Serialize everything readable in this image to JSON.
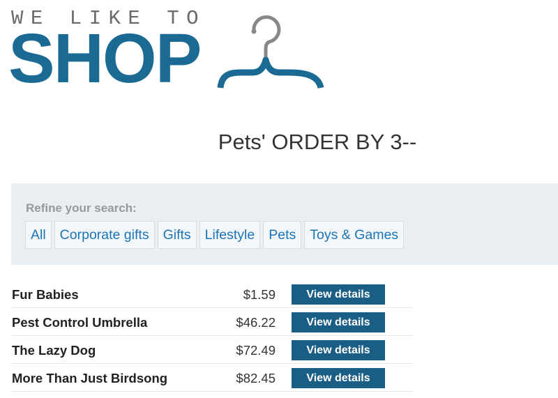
{
  "logo": {
    "tagline": "WE LIKE TO",
    "word": "SHOP",
    "icon": "hanger-icon",
    "color": "#1a6a94"
  },
  "page": {
    "title": "Pets' ORDER BY 3--"
  },
  "filters": {
    "label": "Refine your search:",
    "items": [
      "All",
      "Corporate gifts",
      "Gifts",
      "Lifestyle",
      "Pets",
      "Toys & Games"
    ]
  },
  "products": [
    {
      "name": "Fur Babies",
      "price": "$1.59",
      "button": "View details"
    },
    {
      "name": "Pest Control Umbrella",
      "price": "$46.22",
      "button": "View details"
    },
    {
      "name": "The Lazy Dog",
      "price": "$72.49",
      "button": "View details"
    },
    {
      "name": "More Than Just Birdsong",
      "price": "$82.45",
      "button": "View details"
    }
  ],
  "colors": {
    "accent": "#1a5e86",
    "link": "#1a74b8",
    "panel": "#e8eef1"
  }
}
